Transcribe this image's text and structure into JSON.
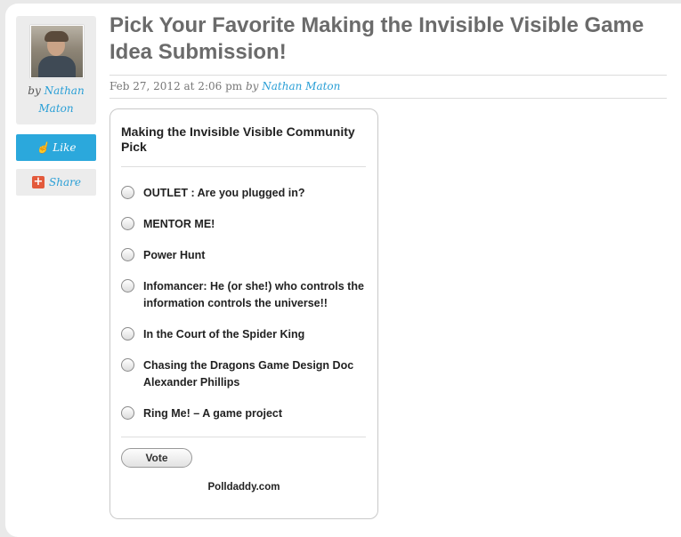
{
  "author": {
    "by": "by",
    "name_line1": "Nathan",
    "name_line2": "Maton"
  },
  "social": {
    "like_label": "Like",
    "share_label": "Share"
  },
  "post": {
    "title": "Pick Your Favorite Making the Invisible Visible Game Idea Submission!",
    "date": "Feb 27, 2012 at 2:06 pm",
    "by": "by",
    "author": "Nathan Maton"
  },
  "poll": {
    "question": "Making the Invisible Visible Community Pick",
    "options": [
      "OUTLET : Are you plugged in?",
      "MENTOR ME!",
      "Power Hunt",
      "Infomancer: He (or she!) who controls the information controls the universe!!",
      "In the Court of the Spider King",
      "Chasing the Dragons Game Design Doc Alexander Phillips",
      "Ring Me! – A game project"
    ],
    "vote_label": "Vote",
    "footer": "Polldaddy.com"
  }
}
